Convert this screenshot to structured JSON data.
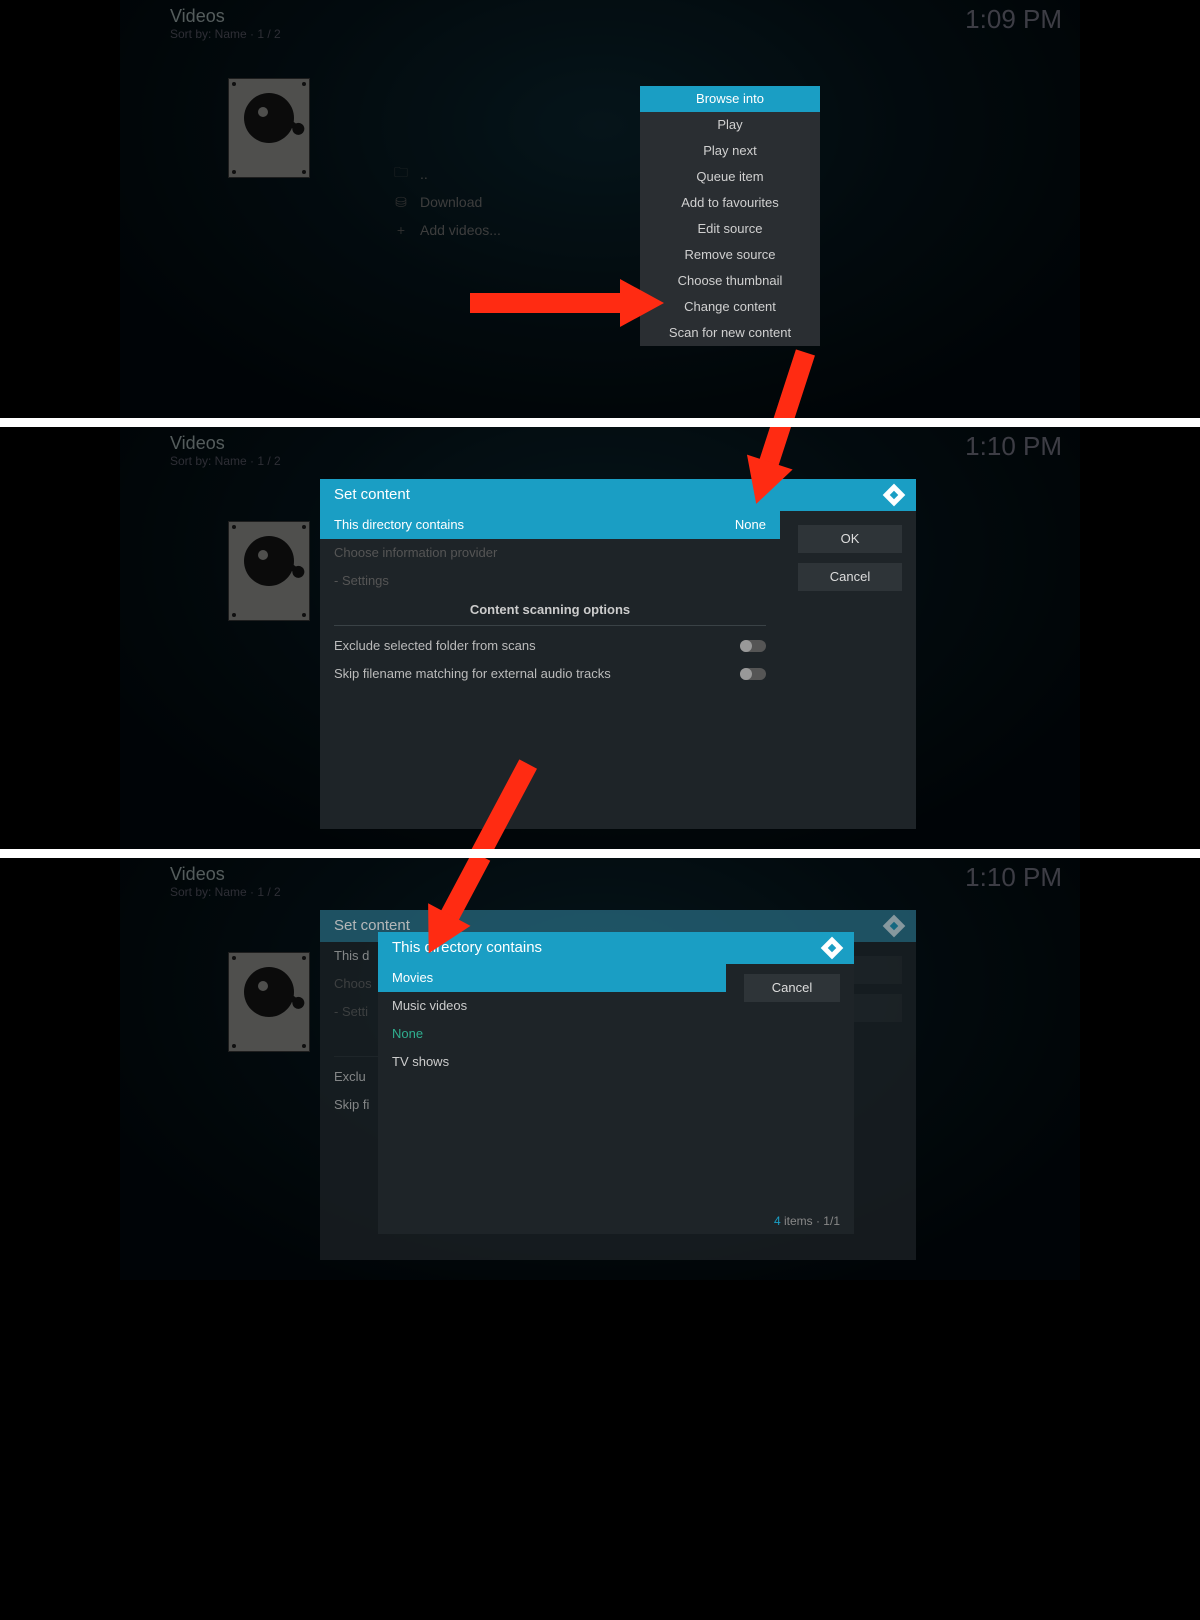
{
  "panel1": {
    "title": "Videos",
    "sort": "Sort by: Name · 1 / 2",
    "time": "1:09 PM",
    "files": {
      "up": "..",
      "download": "Download",
      "add": "Add videos..."
    },
    "menu": {
      "items": [
        "Browse into",
        "Play",
        "Play next",
        "Queue item",
        "Add to favourites",
        "Edit source",
        "Remove source",
        "Choose thumbnail",
        "Change content",
        "Scan for new content"
      ],
      "highlight": 0
    }
  },
  "panel2": {
    "title": "Videos",
    "sort": "Sort by: Name · 1 / 2",
    "time": "1:10 PM",
    "dlg": {
      "title": "Set content",
      "row_dir": "This directory contains",
      "row_dir_val": "None",
      "row_provider": "Choose information provider",
      "row_settings": "- Settings",
      "section": "Content scanning options",
      "opt1": "Exclude selected folder from scans",
      "opt2": "Skip filename matching for external audio tracks",
      "ok": "OK",
      "cancel": "Cancel"
    }
  },
  "panel3": {
    "title": "Videos",
    "sort": "Sort by: Name · 1 / 2",
    "time": "1:10 PM",
    "dlg": {
      "title": "Set content",
      "row_dir": "This d",
      "row_provider": "Choos",
      "row_settings": "- Setti",
      "opt1": "Exclu",
      "opt2": "Skip fi"
    },
    "sub": {
      "title": "This directory contains",
      "items": [
        "Movies",
        "Music videos",
        "None",
        "TV shows"
      ],
      "highlight": 0,
      "current": 2,
      "cancel": "Cancel",
      "foot_n": "4",
      "foot_txt": " items · 1/1"
    }
  }
}
